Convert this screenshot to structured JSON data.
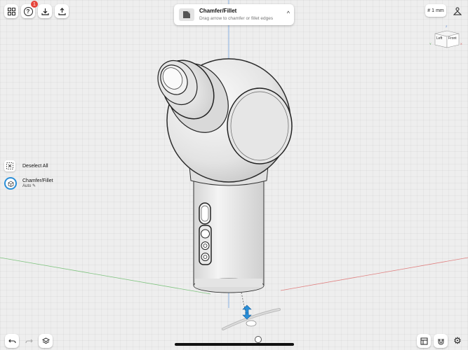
{
  "hint": {
    "title": "Chamfer/Fillet",
    "subtitle": "Drag arrow to chamfer or fillet edges"
  },
  "help_badge": "1",
  "units": {
    "value": "1",
    "unit": "mm"
  },
  "view_cube": {
    "left": "Left",
    "front": "Front",
    "axis_z": "Z",
    "axis_x": "X",
    "axis_y": "Y"
  },
  "side_panel": {
    "deselect_label": "Deselect All",
    "tool_label": "Chamfer/Fillet",
    "tool_mode": "Auto"
  },
  "colors": {
    "accent": "#2a8fd8",
    "badge": "#e5443a"
  }
}
